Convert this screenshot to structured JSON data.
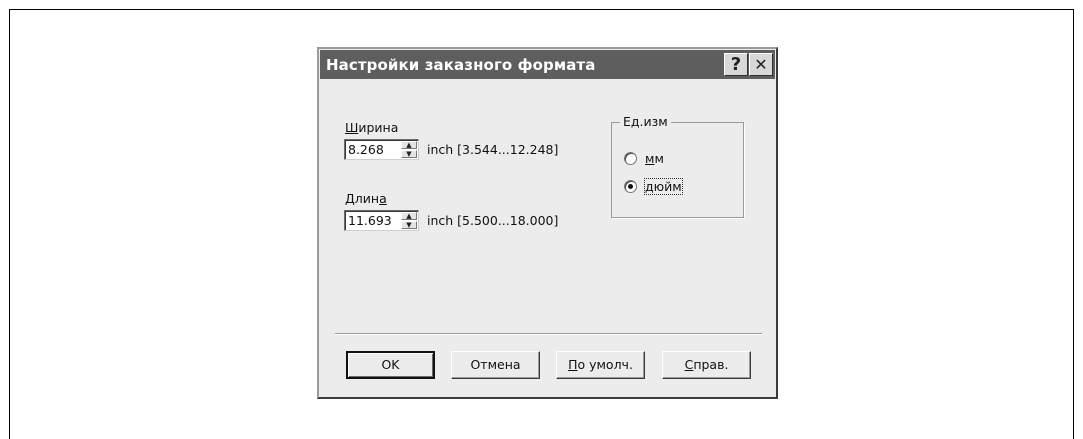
{
  "dialog": {
    "title": "Настройки заказного формата",
    "help_button": "?",
    "close_button": "✕"
  },
  "width": {
    "label_underlined": "Ш",
    "label_rest": "ирина",
    "value": "8.268",
    "range": "inch [3.544...12.248]"
  },
  "length": {
    "label_start": "Длин",
    "label_underlined": "а",
    "value": "11.693",
    "range": "inch [5.500...18.000]"
  },
  "units": {
    "legend": "Ед.изм",
    "options": [
      {
        "label_underlined": "м",
        "label_rest": "м",
        "selected": false
      },
      {
        "label_underlined": "д",
        "label_rest": "юйм",
        "selected": true
      }
    ]
  },
  "buttons": {
    "ok": "OK",
    "cancel": "Отмена",
    "default_underlined": "П",
    "default_rest": "о умолч.",
    "help_underlined": "С",
    "help_rest": "прав."
  },
  "icons": {
    "spin_up": "▲",
    "spin_down": "▼"
  }
}
